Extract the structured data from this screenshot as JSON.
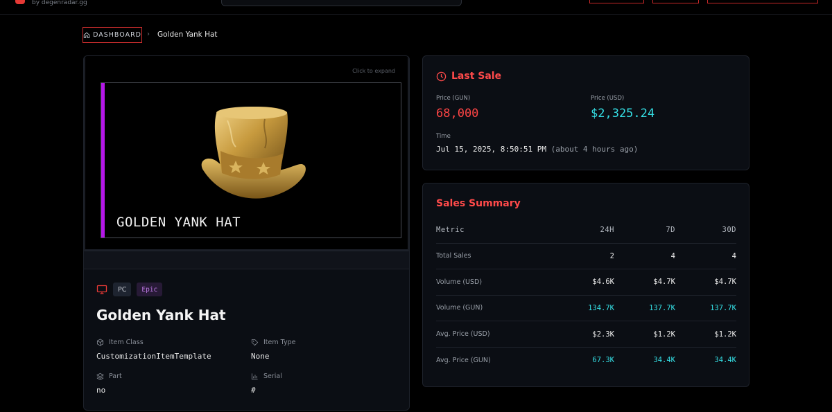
{
  "header": {
    "byline": "by degenradar.gg"
  },
  "breadcrumb": {
    "home_label": "DASHBOARD",
    "separator": "›",
    "current": "Golden Yank Hat"
  },
  "item": {
    "click_hint": "Click to expand",
    "image_title": "GOLDEN YANK HAT",
    "rarity_color": "#b517e8",
    "platform_icon": "monitor-icon",
    "tags": {
      "platform": "PC",
      "rarity": "Epic"
    },
    "name": "Golden Yank Hat",
    "attributes": {
      "item_class": {
        "label": "Item Class",
        "value": "CustomizationItemTemplate",
        "icon": "cube-icon"
      },
      "item_type": {
        "label": "Item Type",
        "value": "None",
        "icon": "tag-icon"
      },
      "part": {
        "label": "Part",
        "value": "no",
        "icon": "layers-icon"
      },
      "serial": {
        "label": "Serial",
        "value": "#",
        "icon": "bar-chart-icon"
      }
    }
  },
  "last_sale": {
    "title": "Last Sale",
    "icon": "clock-icon",
    "price_gun_label": "Price (GUN)",
    "price_gun": "68,000",
    "price_usd_label": "Price (USD)",
    "price_usd": "$2,325.24",
    "time_label": "Time",
    "time": "Jul 15, 2025, 8:50:51 PM",
    "time_relative": "(about 4 hours ago)"
  },
  "sales_summary": {
    "title": "Sales Summary",
    "headers": [
      "Metric",
      "24H",
      "7D",
      "30D"
    ],
    "rows": [
      {
        "metric": "Total Sales",
        "h24": "2",
        "d7": "4",
        "d30": "4"
      },
      {
        "metric": "Volume (USD)",
        "h24": "$4.6K",
        "d7": "$4.7K",
        "d30": "$4.7K"
      },
      {
        "metric": "Volume (GUN)",
        "h24": "134.7K",
        "d7": "137.7K",
        "d30": "137.7K"
      },
      {
        "metric": "Avg. Price (USD)",
        "h24": "$2.3K",
        "d7": "$1.2K",
        "d30": "$1.2K"
      },
      {
        "metric": "Avg. Price (GUN)",
        "h24": "67.3K",
        "d7": "34.4K",
        "d30": "34.4K"
      }
    ]
  },
  "colors": {
    "accent_red": "#ff4a4a",
    "gun_red": "#ff4545",
    "usd_cyan": "#35e0e6",
    "epic_purple": "#b517e8"
  }
}
